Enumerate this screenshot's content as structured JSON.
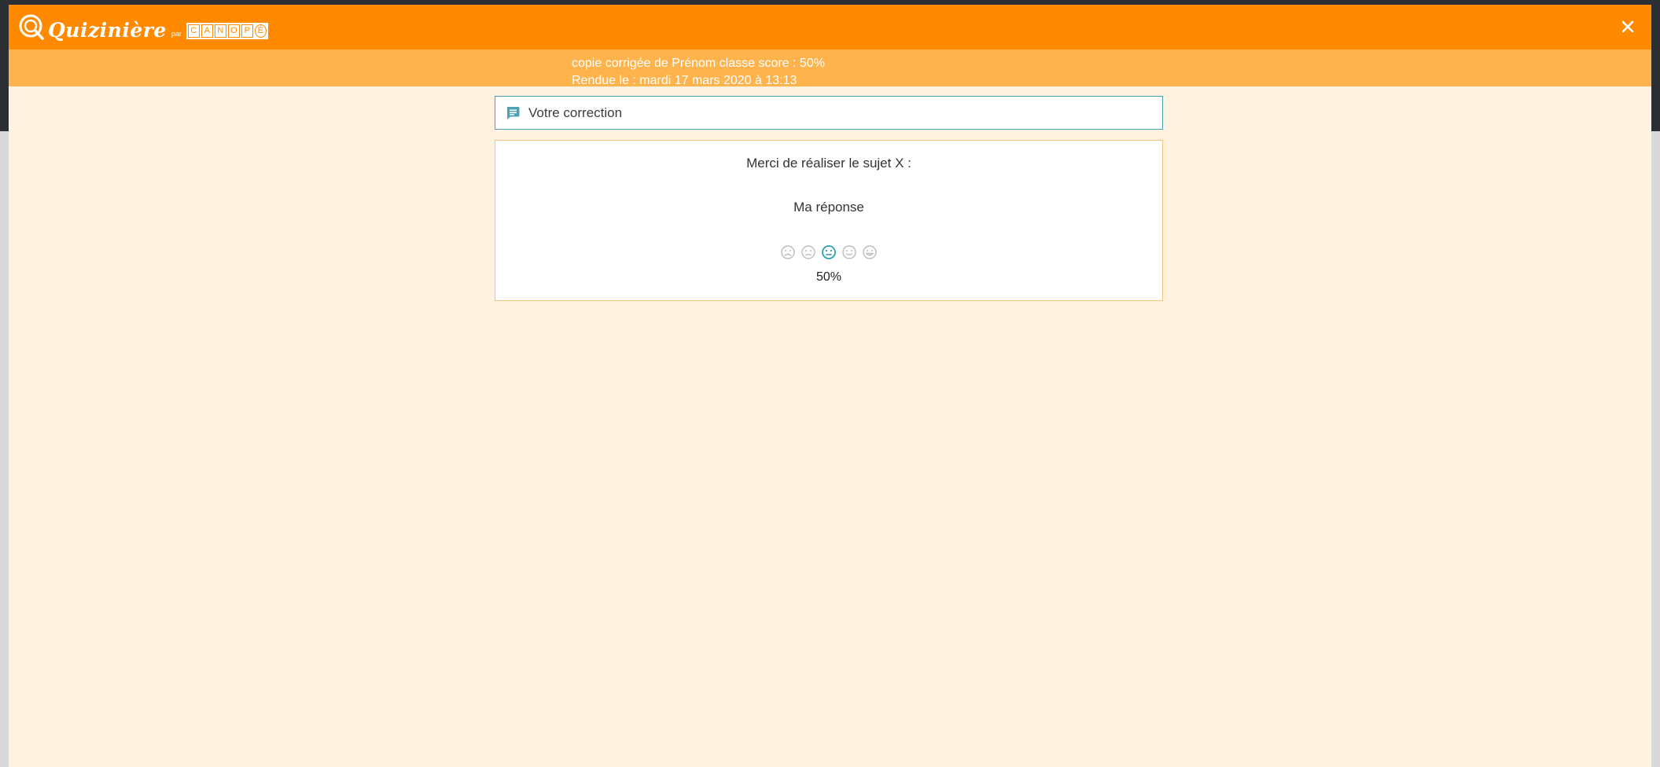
{
  "brand": {
    "name": "Quizinière",
    "par": "par",
    "partner_letters": [
      "C",
      "A",
      "N",
      "O",
      "P",
      "É"
    ],
    "primary_color": "#ff8a00",
    "secondary_color": "#ffb34d",
    "background_color": "#fff2e0"
  },
  "header": {
    "close_icon": "close-icon"
  },
  "subheader": {
    "line1": "copie corrigée de Prénom classe score : 50%",
    "line2": "Rendue le : mardi 17 mars 2020 à 13:13"
  },
  "correction": {
    "icon": "comment-icon",
    "label": "Votre correction",
    "accent_color": "#4aa3b5"
  },
  "assignment": {
    "instruction": "Merci de réaliser le sujet X :",
    "answer": "Ma réponse",
    "rating": {
      "faces": [
        "very-sad-face-icon",
        "sad-face-icon",
        "neutral-face-icon",
        "happy-face-icon",
        "very-happy-face-icon"
      ],
      "selected_index": 2,
      "score_label": "50%"
    }
  }
}
